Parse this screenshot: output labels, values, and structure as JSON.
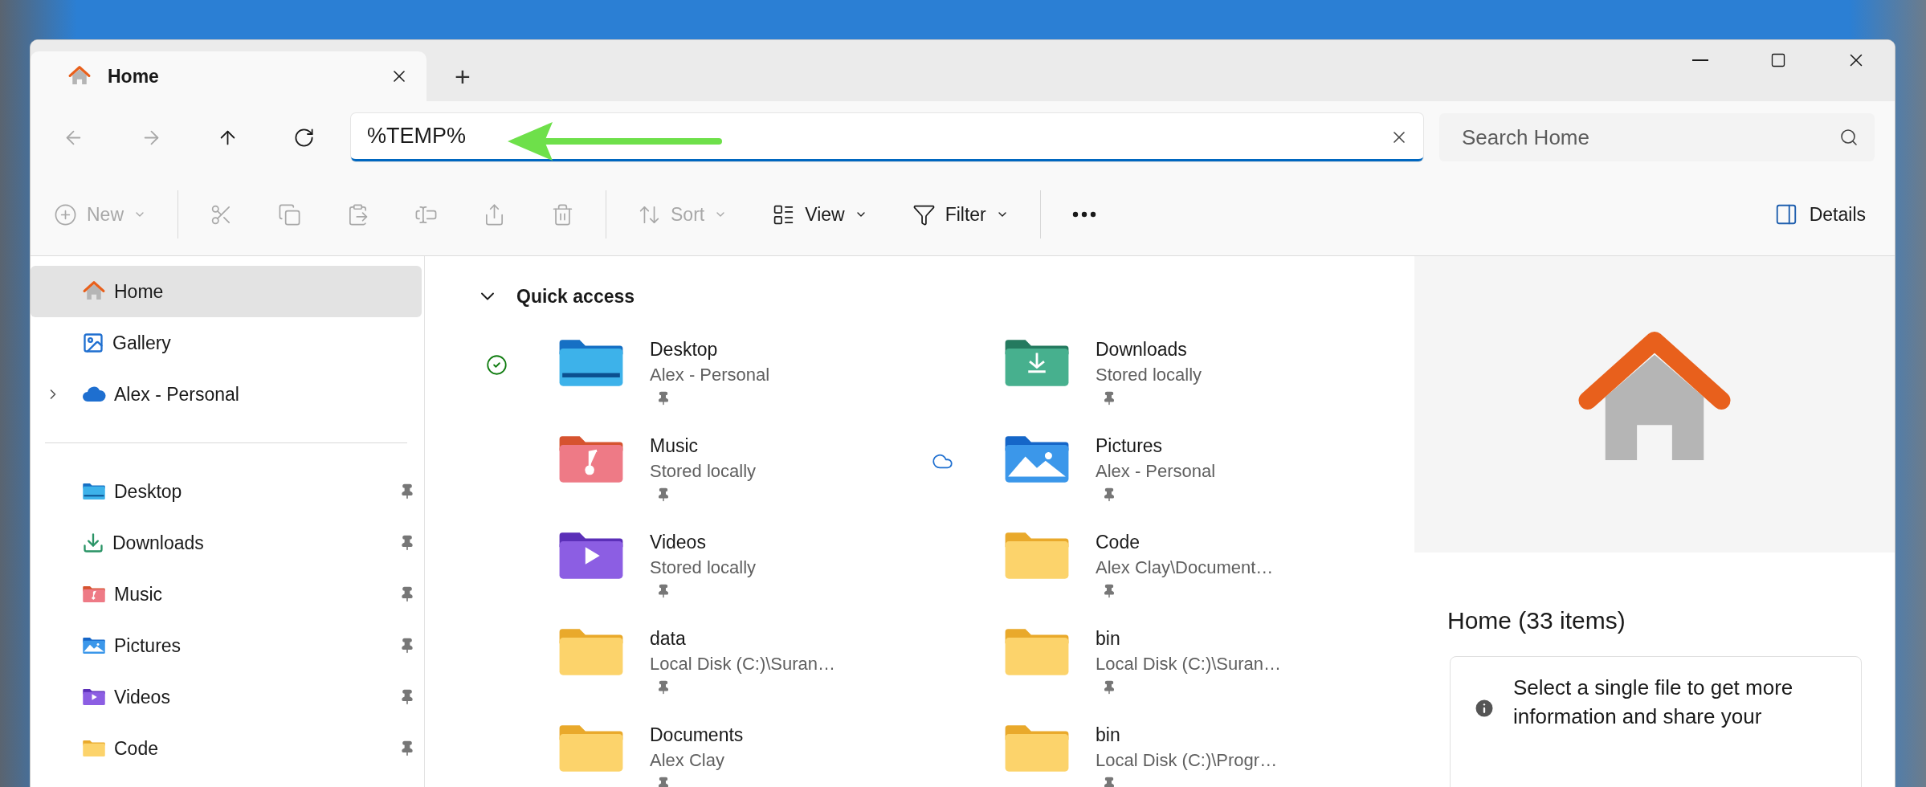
{
  "tabs": [
    {
      "label": "Home",
      "selected": true
    }
  ],
  "new_tab": "+",
  "nav": [
    {
      "kind": "back",
      "disabled": true
    },
    {
      "kind": "forward",
      "disabled": true
    },
    {
      "kind": "up",
      "disabled": false
    },
    {
      "kind": "refresh",
      "disabled": false
    }
  ],
  "address": {
    "value": "%TEMP%"
  },
  "search": {
    "placeholder": "Search Home"
  },
  "toolbar": [
    {
      "kind": "new",
      "label": "New",
      "disabled": true
    },
    {
      "kind": "cut",
      "disabled": true
    },
    {
      "kind": "copy",
      "disabled": true
    },
    {
      "kind": "paste",
      "disabled": true
    },
    {
      "kind": "rename",
      "disabled": true
    },
    {
      "kind": "share",
      "disabled": true
    },
    {
      "kind": "delete",
      "disabled": true
    },
    {
      "kind": "sort",
      "label": "Sort",
      "disabled": true
    },
    {
      "kind": "view",
      "label": "View",
      "disabled": false
    },
    {
      "kind": "filter",
      "label": "Filter",
      "disabled": false
    },
    {
      "kind": "more",
      "disabled": false
    }
  ],
  "details_button": "Details",
  "sidebar": {
    "items": [
      {
        "label": "Home",
        "kind": "home",
        "selected": true
      },
      {
        "label": "Gallery",
        "kind": "gallery",
        "selected": false
      },
      {
        "label": "Alex - Personal",
        "kind": "cloud",
        "selected": false,
        "expanded": false
      }
    ],
    "pinned": [
      {
        "label": "Desktop",
        "kind": "desktop",
        "selected": false,
        "pinned": true
      },
      {
        "label": "Downloads",
        "kind": "downloads",
        "selected": false,
        "pinned": true
      },
      {
        "label": "Music",
        "kind": "music",
        "selected": false,
        "pinned": true
      },
      {
        "label": "Pictures",
        "kind": "pictures",
        "selected": false,
        "pinned": true
      },
      {
        "label": "Videos",
        "kind": "videos",
        "selected": false,
        "pinned": true
      },
      {
        "label": "Code",
        "kind": "folder",
        "selected": false,
        "pinned": true
      }
    ]
  },
  "quick_access": {
    "title": "Quick access",
    "expanded": true,
    "items": [
      {
        "name": "Desktop",
        "location": "Alex - Personal",
        "kind": "desktop",
        "synced": true,
        "online_only": false,
        "pinned": true
      },
      {
        "name": "Downloads",
        "location": "Stored locally",
        "kind": "downloads",
        "synced": false,
        "online_only": false,
        "pinned": true
      },
      {
        "name": "Music",
        "location": "Stored locally",
        "kind": "music",
        "synced": false,
        "online_only": false,
        "pinned": true
      },
      {
        "name": "Pictures",
        "location": "Alex - Personal",
        "kind": "pictures",
        "synced": false,
        "online_only": true,
        "pinned": true
      },
      {
        "name": "Videos",
        "location": "Stored locally",
        "kind": "videos",
        "synced": false,
        "online_only": false,
        "pinned": true
      },
      {
        "name": "Code",
        "location": "Alex Clay\\Document…",
        "kind": "folder",
        "synced": false,
        "online_only": false,
        "pinned": true
      },
      {
        "name": "data",
        "location": "Local Disk (C:)\\Suran…",
        "kind": "folder",
        "synced": false,
        "online_only": false,
        "pinned": true
      },
      {
        "name": "bin",
        "location": "Local Disk (C:)\\Suran…",
        "kind": "folder",
        "synced": false,
        "online_only": false,
        "pinned": true
      },
      {
        "name": "Documents",
        "location": "Alex Clay",
        "kind": "folder",
        "synced": false,
        "online_only": false,
        "pinned": true
      },
      {
        "name": "bin",
        "location": "Local Disk (C:)\\Progr…",
        "kind": "folder",
        "synced": false,
        "online_only": false,
        "pinned": true
      }
    ]
  },
  "details": {
    "title": "Home (33 items)",
    "message": "Select a single file to get more information and share your"
  }
}
